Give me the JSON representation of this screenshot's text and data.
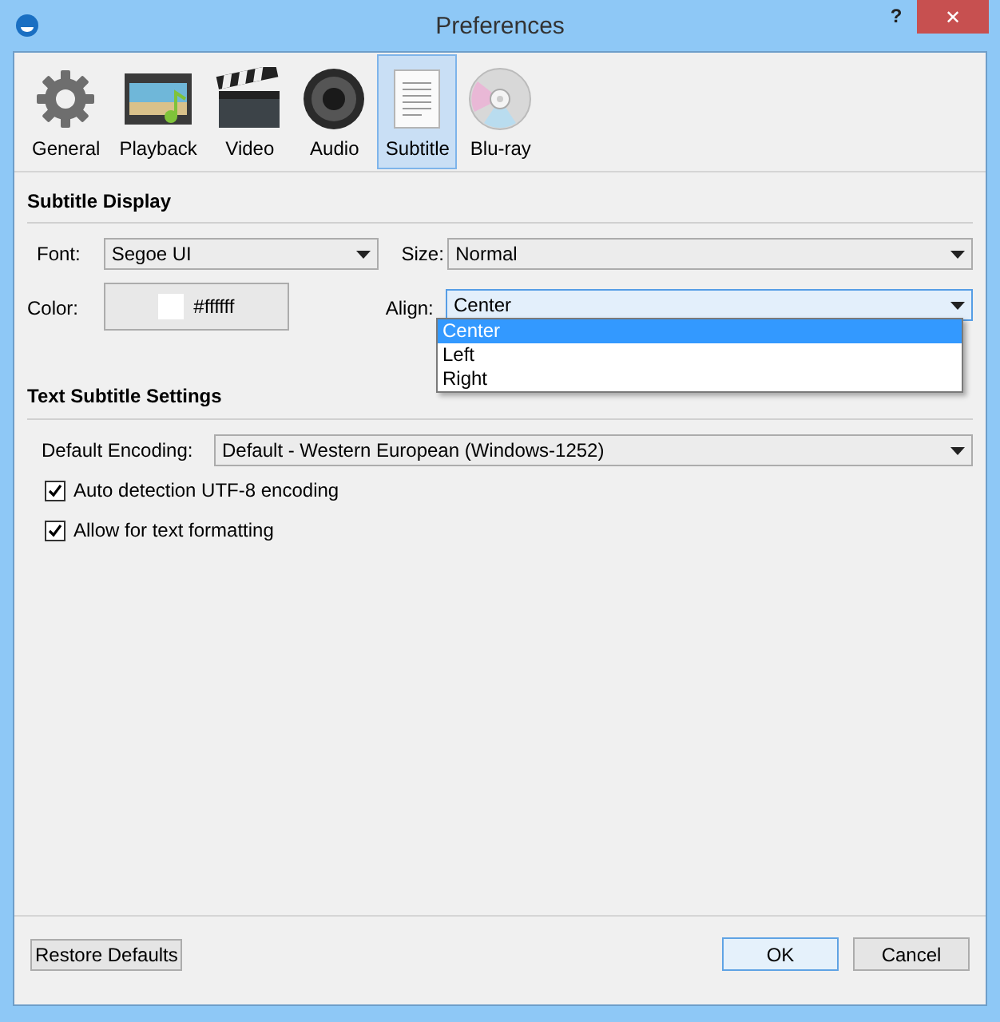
{
  "window": {
    "title": "Preferences",
    "help": "?",
    "close": "✕"
  },
  "tabs": [
    {
      "label": "General",
      "kind": "gear",
      "selected": false
    },
    {
      "label": "Playback",
      "kind": "film",
      "selected": false
    },
    {
      "label": "Video",
      "kind": "clapper",
      "selected": false
    },
    {
      "label": "Audio",
      "kind": "speaker",
      "selected": false
    },
    {
      "label": "Subtitle",
      "kind": "document",
      "selected": true
    },
    {
      "label": "Blu-ray",
      "kind": "disc",
      "selected": false
    }
  ],
  "subtitle_display": {
    "heading": "Subtitle Display",
    "font": {
      "label": "Font:",
      "value": "Segoe UI"
    },
    "size": {
      "label": "Size:",
      "value": "Normal"
    },
    "color": {
      "label": "Color:",
      "value": "#ffffff"
    },
    "align": {
      "label": "Align:",
      "value": "Center",
      "expanded": true,
      "options": [
        {
          "label": "Center",
          "selected": true
        },
        {
          "label": "Left",
          "selected": false
        },
        {
          "label": "Right",
          "selected": false
        }
      ]
    }
  },
  "text_subtitle_settings": {
    "heading": "Text Subtitle Settings",
    "encoding": {
      "label": "Default Encoding:",
      "value": "Default - Western European (Windows-1252)"
    },
    "checkboxes": [
      {
        "label": "Auto detection UTF-8 encoding",
        "checked": true
      },
      {
        "label": "Allow for text formatting",
        "checked": true
      }
    ]
  },
  "buttons": {
    "restore": "Restore Defaults",
    "ok": "OK",
    "cancel": "Cancel"
  }
}
